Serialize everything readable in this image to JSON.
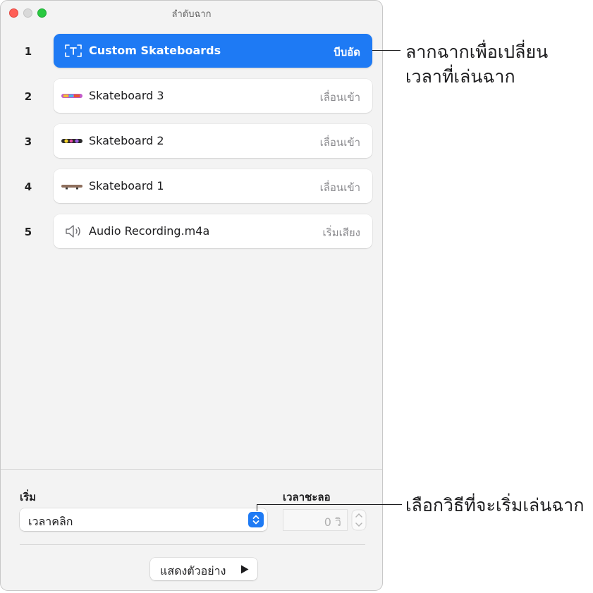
{
  "window": {
    "title": "ลำดับฉาก"
  },
  "rows": [
    {
      "number": "1",
      "name": "Custom Skateboards",
      "effect": "บีบอัด",
      "icon": "text-box-icon",
      "selected": true
    },
    {
      "number": "2",
      "name": "Skateboard 3",
      "effect": "เลื่อนเข้า",
      "icon": "skateboard-thumbnail"
    },
    {
      "number": "3",
      "name": "Skateboard 2",
      "effect": "เลื่อนเข้า",
      "icon": "skateboard-thumbnail"
    },
    {
      "number": "4",
      "name": "Skateboard 1",
      "effect": "เลื่อนเข้า",
      "icon": "skateboard-thumbnail"
    },
    {
      "number": "5",
      "name": "Audio Recording.m4a",
      "effect": "เริ่มเสียง",
      "icon": "speaker-icon"
    }
  ],
  "start": {
    "label": "เริ่ม",
    "value": "เวลาคลิก"
  },
  "delay": {
    "label": "เวลาชะลอ",
    "value": "0 วิ"
  },
  "preview": {
    "label": "แสดงตัวอย่าง",
    "icon": "play-icon"
  },
  "callouts": {
    "reorder": [
      "ลากฉากเพื่อเปลี่ยน",
      "เวลาที่เล่นฉาก"
    ],
    "start_method": "เลือกวิธีที่จะเริ่มเล่นฉาก"
  },
  "colors": {
    "accent": "#1e7af4",
    "close": "#ff5f57",
    "zoom": "#29c940"
  }
}
